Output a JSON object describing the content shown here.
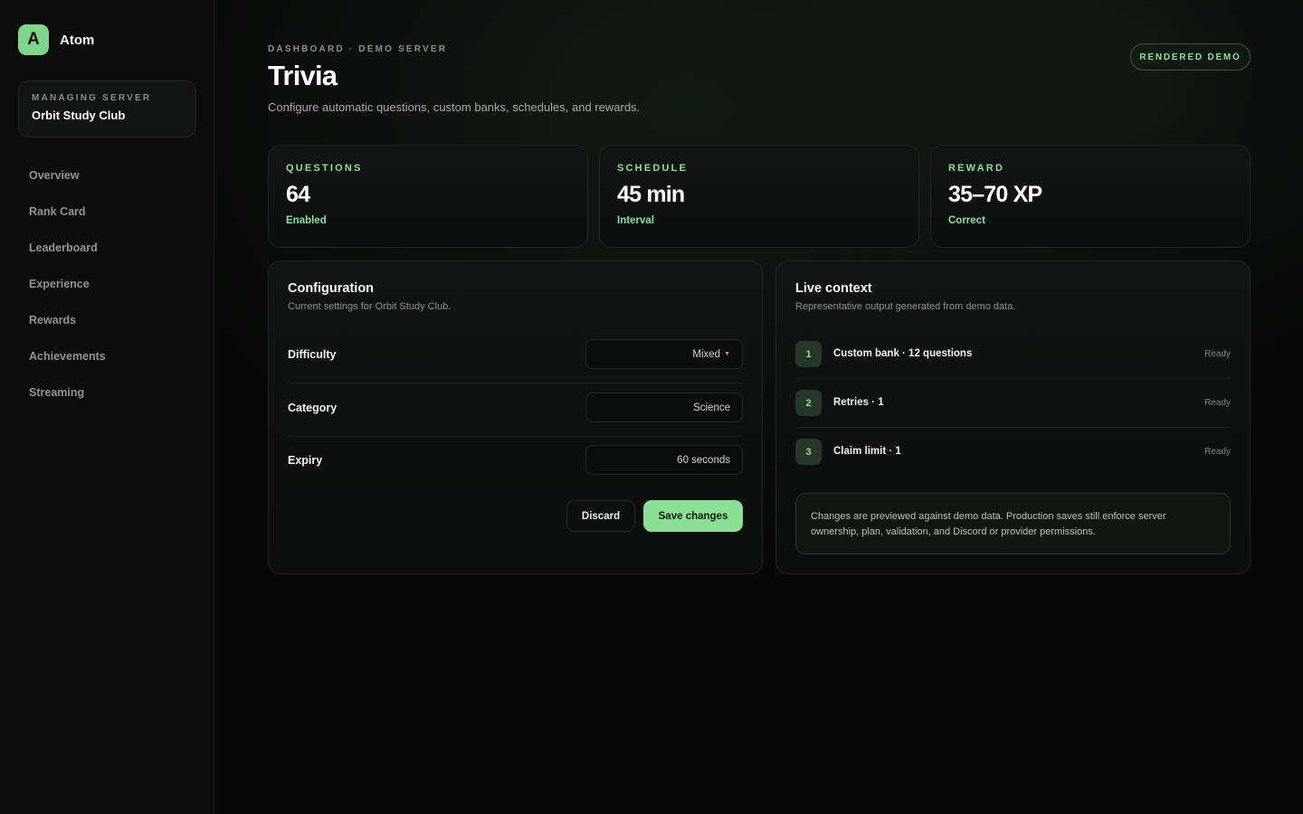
{
  "brand": {
    "logo_letter": "A",
    "name": "Atom"
  },
  "server": {
    "eyebrow": "MANAGING SERVER",
    "name": "Orbit Study Club"
  },
  "nav": {
    "items": [
      {
        "label": "Overview"
      },
      {
        "label": "Rank Card"
      },
      {
        "label": "Leaderboard"
      },
      {
        "label": "Experience"
      },
      {
        "label": "Rewards"
      },
      {
        "label": "Achievements"
      },
      {
        "label": "Streaming"
      }
    ]
  },
  "header": {
    "eyebrow": "DASHBOARD · DEMO SERVER",
    "title": "Trivia",
    "subtitle": "Configure automatic questions, custom banks, schedules, and rewards.",
    "badge": "RENDERED DEMO"
  },
  "stats": [
    {
      "label": "QUESTIONS",
      "value": "64",
      "note": "Enabled"
    },
    {
      "label": "SCHEDULE",
      "value": "45 min",
      "note": "Interval"
    },
    {
      "label": "REWARD",
      "value": "35–70 XP",
      "note": "Correct"
    }
  ],
  "configuration": {
    "title": "Configuration",
    "subtitle": "Current settings for Orbit Study Club.",
    "rows": [
      {
        "label": "Difficulty",
        "value": "Mixed",
        "kind": "select"
      },
      {
        "label": "Category",
        "value": "Science",
        "kind": "input"
      },
      {
        "label": "Expiry",
        "value": "60 seconds",
        "kind": "input"
      }
    ],
    "discard_label": "Discard",
    "save_label": "Save changes"
  },
  "live_context": {
    "title": "Live context",
    "subtitle": "Representative output generated from demo data.",
    "items": [
      {
        "num": "1",
        "text": "Custom bank · 12 questions",
        "status": "Ready"
      },
      {
        "num": "2",
        "text": "Retries · 1",
        "status": "Ready"
      },
      {
        "num": "3",
        "text": "Claim limit · 1",
        "status": "Ready"
      }
    ],
    "note": "Changes are previewed against demo data. Production saves still enforce server ownership, plan, validation, and Discord or provider permissions."
  },
  "colors": {
    "accent": "#8be096",
    "background": "#070807",
    "panel": "#111412",
    "muted_text": "#8f9690"
  }
}
